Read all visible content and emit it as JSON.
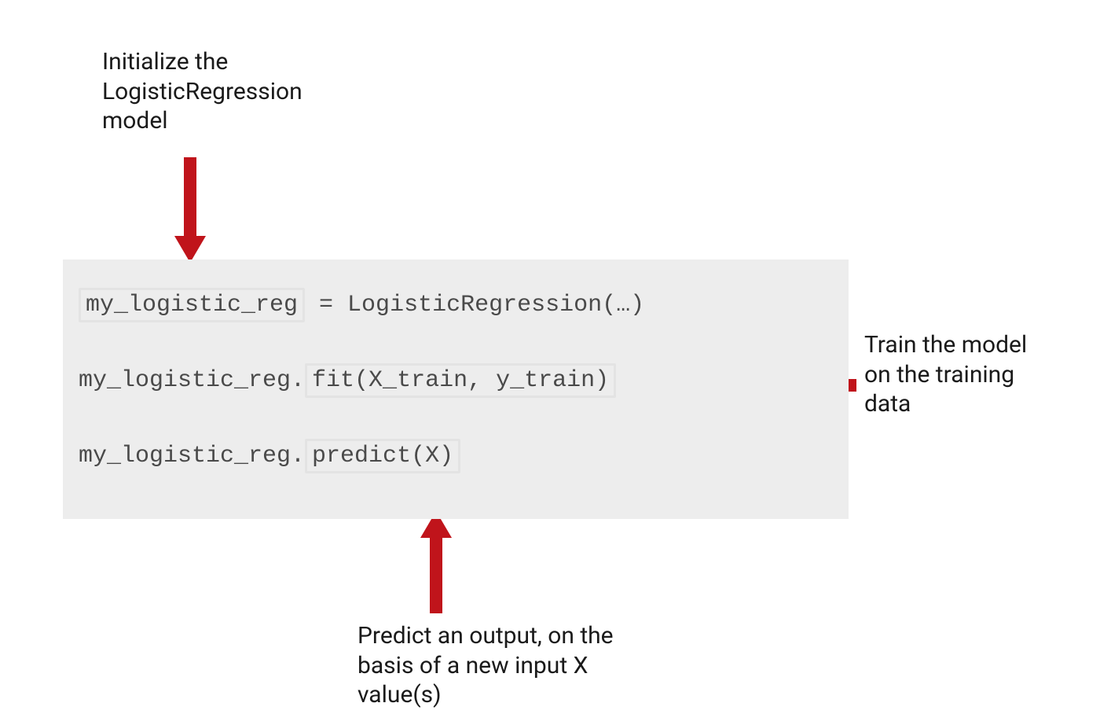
{
  "annotations": {
    "top": "Initialize the LogisticRegression model",
    "right": "Train the model on the training data",
    "bottom": "Predict an output, on the basis of a new input X value(s)"
  },
  "code": {
    "line1": {
      "highlighted_var": "my_logistic_reg",
      "rest": " = LogisticRegression(…)"
    },
    "line2": {
      "prefix": "my_logistic_reg.",
      "highlighted_call": "fit(X_train, y_train)"
    },
    "line3": {
      "prefix": "my_logistic_reg.",
      "highlighted_call": "predict(X)"
    }
  },
  "colors": {
    "accent": "#c0141b",
    "code_bg": "#ededed",
    "code_text": "#4a4a4a",
    "highlight_border": "#e3e3e3"
  }
}
